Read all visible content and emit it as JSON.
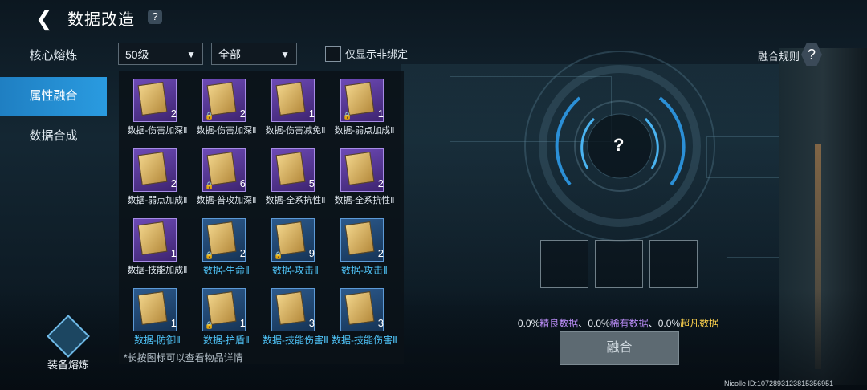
{
  "header": {
    "back_icon": "back-arrow-icon",
    "title": "数据改造",
    "help": "?"
  },
  "sidebar": {
    "items": [
      {
        "label": "核心熔炼",
        "active": false
      },
      {
        "label": "属性融合",
        "active": true
      },
      {
        "label": "数据合成",
        "active": false
      }
    ],
    "equip_label": "装备熔炼"
  },
  "filters": {
    "level": "50级",
    "category": "全部",
    "checkbox_label": "仅显示非绑定"
  },
  "inventory": [
    {
      "name": "数据-伤害加深Ⅱ",
      "count": "2",
      "rarity": "purple",
      "locked": false
    },
    {
      "name": "数据-伤害加深Ⅱ",
      "count": "2",
      "rarity": "purple",
      "locked": true
    },
    {
      "name": "数据-伤害减免Ⅱ",
      "count": "1",
      "rarity": "purple",
      "locked": false
    },
    {
      "name": "数据-弱点加成Ⅱ",
      "count": "1",
      "rarity": "purple",
      "locked": true
    },
    {
      "name": "数据-弱点加成Ⅱ",
      "count": "2",
      "rarity": "purple",
      "locked": false
    },
    {
      "name": "数据-普攻加深Ⅱ",
      "count": "6",
      "rarity": "purple",
      "locked": true
    },
    {
      "name": "数据-全系抗性Ⅱ",
      "count": "5",
      "rarity": "purple",
      "locked": false
    },
    {
      "name": "数据-全系抗性Ⅱ",
      "count": "2",
      "rarity": "purple",
      "locked": false
    },
    {
      "name": "数据-技能加成Ⅱ",
      "count": "1",
      "rarity": "purple",
      "locked": false
    },
    {
      "name": "数据-生命Ⅱ",
      "count": "2",
      "rarity": "blue",
      "locked": true
    },
    {
      "name": "数据-攻击Ⅱ",
      "count": "9",
      "rarity": "blue",
      "locked": true
    },
    {
      "name": "数据-攻击Ⅱ",
      "count": "2",
      "rarity": "blue",
      "locked": false
    },
    {
      "name": "数据-防御Ⅱ",
      "count": "1",
      "rarity": "blue",
      "locked": false
    },
    {
      "name": "数据-护盾Ⅱ",
      "count": "1",
      "rarity": "blue",
      "locked": true
    },
    {
      "name": "数据-技能伤害Ⅱ",
      "count": "3",
      "rarity": "blue",
      "locked": false
    },
    {
      "name": "数据-技能伤害Ⅱ",
      "count": "3",
      "rarity": "blue",
      "locked": false
    }
  ],
  "hint": "*长按图标可以查看物品详情",
  "fusion": {
    "rules_label": "融合规则",
    "center_symbol": "?",
    "rates": [
      {
        "pct": "0.0%",
        "label": "精良数据",
        "color": "#b98cf5"
      },
      {
        "sep": "、"
      },
      {
        "pct": "0.0%",
        "label": "稀有数据",
        "color": "#b98cf5"
      },
      {
        "sep": "、"
      },
      {
        "pct": "0.0%",
        "label": "超凡数据",
        "color": "#ffd34d"
      }
    ],
    "button_label": "融合"
  },
  "user_id": "Nicolle ID:1072893123815356951"
}
